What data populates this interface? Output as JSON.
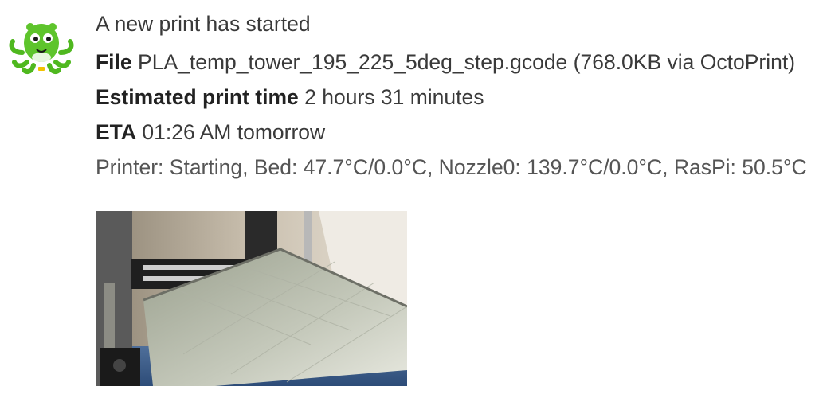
{
  "sender": {
    "avatar_icon": "octopus-logo-icon",
    "brand_color": "#5ec42c"
  },
  "message": {
    "title": "A new print has started",
    "file": {
      "label": "File",
      "value": "PLA_temp_tower_195_225_5deg_step.gcode (768.0KB via OctoPrint)"
    },
    "estimated_time": {
      "label": "Estimated print time",
      "value": "2 hours 31 minutes"
    },
    "eta": {
      "label": "ETA",
      "value": "01:26 AM tomorrow"
    },
    "status": "Printer: Starting, Bed: 47.7°C/0.0°C, Nozzle0: 139.7°C/0.0°C, RasPi: 50.5°C"
  },
  "snapshot": {
    "subject": "printer-bed-photo"
  }
}
